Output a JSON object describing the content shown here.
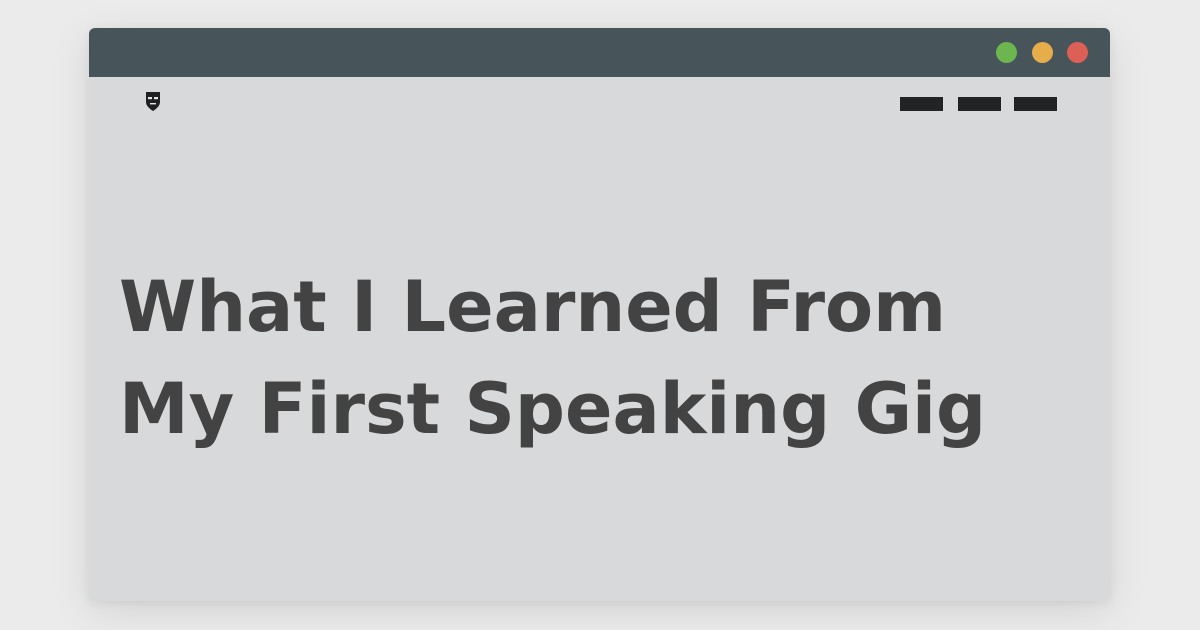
{
  "window": {
    "controls": [
      {
        "name": "green-dot",
        "color": "#6db64f"
      },
      {
        "name": "yellow-dot",
        "color": "#e5ae4a"
      },
      {
        "name": "red-dot",
        "color": "#dd6057"
      }
    ]
  },
  "header": {
    "logo_icon": "mask-shield-icon",
    "nav_items": [
      "nav-placeholder-1",
      "nav-placeholder-2",
      "nav-placeholder-3"
    ]
  },
  "main": {
    "title_line1": "What I Learned From",
    "title_line2": "My First Speaking Gig"
  },
  "colors": {
    "page_background": "#ebebeb",
    "window_background": "#d8d9db",
    "titlebar": "#475459",
    "headline": "#434343",
    "nav_bar": "#222324"
  }
}
